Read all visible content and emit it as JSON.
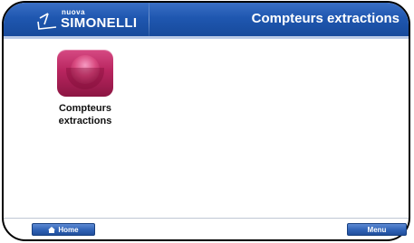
{
  "header": {
    "brand_small": "nuova",
    "brand_big": "SIMONELLI",
    "title": "Compteurs extractions"
  },
  "tiles": [
    {
      "icon": "counter-icon",
      "label_line1": "Compteurs",
      "label_line2": "extractions"
    }
  ],
  "footer": {
    "home_label": "Home",
    "menu_label": "Menu"
  },
  "colors": {
    "header_blue": "#1f57b0",
    "tile_magenta": "#b8255f",
    "button_blue": "#2f62b6"
  }
}
